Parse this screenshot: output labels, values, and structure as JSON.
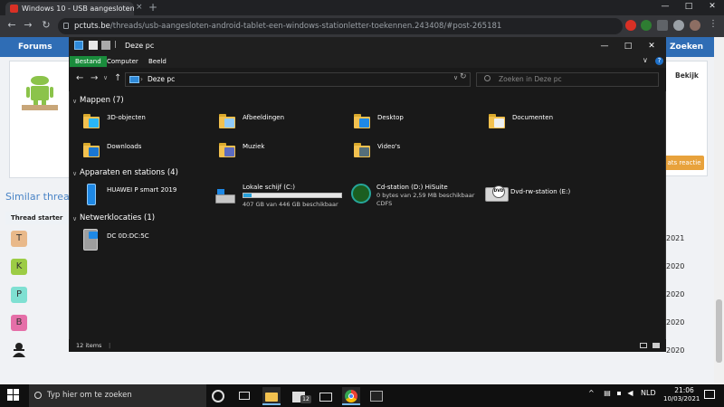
{
  "browser": {
    "tab_title": "Windows 10 - USB aangesloten A",
    "tab_close": "×",
    "new_tab": "+",
    "url_domain": "pctuts.be",
    "url_path": "/threads/usb-aangesloten-android-tablet-een-windows-stationletter-toekennen.243408/#post-265181",
    "nav": {
      "back": "←",
      "forward": "→",
      "reload": "↻"
    },
    "window_controls": {
      "minimize": "—",
      "maximize": "□",
      "close": "✕"
    }
  },
  "site": {
    "forums_label": "Forums",
    "search_label": "Zoeken",
    "bekijk_label": "Bekijk",
    "reactie_label": "ats reactie",
    "similar_title": "Similar thread",
    "thread_starter_header": "Thread starter",
    "avatars": [
      {
        "letter": "T",
        "color": "#e9b98a",
        "year": "2021"
      },
      {
        "letter": "K",
        "color": "#9ccc45",
        "year": "2020"
      },
      {
        "letter": "P",
        "color": "#7fe0d2",
        "year": "2020"
      },
      {
        "letter": "B",
        "color": "#e56fa8",
        "year": "2020"
      },
      {
        "letter": "",
        "color": "#f0f2f5",
        "year": "2020"
      }
    ]
  },
  "explorer": {
    "title": "Deze pc",
    "ribbon_tabs": [
      "Bestand",
      "Computer",
      "Beeld"
    ],
    "address": "Deze pc",
    "address_sep": "›",
    "search_placeholder": "Zoeken in Deze pc",
    "groups": {
      "folders": "Mappen (7)",
      "devices": "Apparaten en stations (4)",
      "network": "Netwerklocaties (1)"
    },
    "folders": [
      "3D-objecten",
      "Afbeeldingen",
      "Desktop",
      "Documenten",
      "Downloads",
      "Muziek",
      "Video's"
    ],
    "devices": [
      {
        "name": "HUAWEI P smart 2019",
        "sub1": "",
        "sub2": ""
      },
      {
        "name": "Lokale schijf (C:)",
        "sub1": "407 GB van 446 GB beschikbaar",
        "sub2": "",
        "used_fraction": 0.087
      },
      {
        "name": "Cd-station (D:) HiSuite",
        "sub1": "0 bytes van 2,59 MB beschikbaar",
        "sub2": "CDFS"
      },
      {
        "name": "Dvd-rw-station (E:)",
        "sub1": "",
        "sub2": ""
      }
    ],
    "network": [
      "DC 0D:DC:5C"
    ],
    "status_items": "12 items",
    "dvd_badge": "DVD",
    "help": "?",
    "expand": "∨"
  },
  "taskbar": {
    "search_placeholder": "Typ hier om te zoeken",
    "tray_lang": "NLD",
    "time": "21:06",
    "date": "10/03/2021",
    "store_badge": "12"
  },
  "colors": {
    "file_tab": "#1a8c3c",
    "folder": "#f2c14f",
    "drive_fill": "#26a0da",
    "site_blue": "#2f6db5"
  }
}
